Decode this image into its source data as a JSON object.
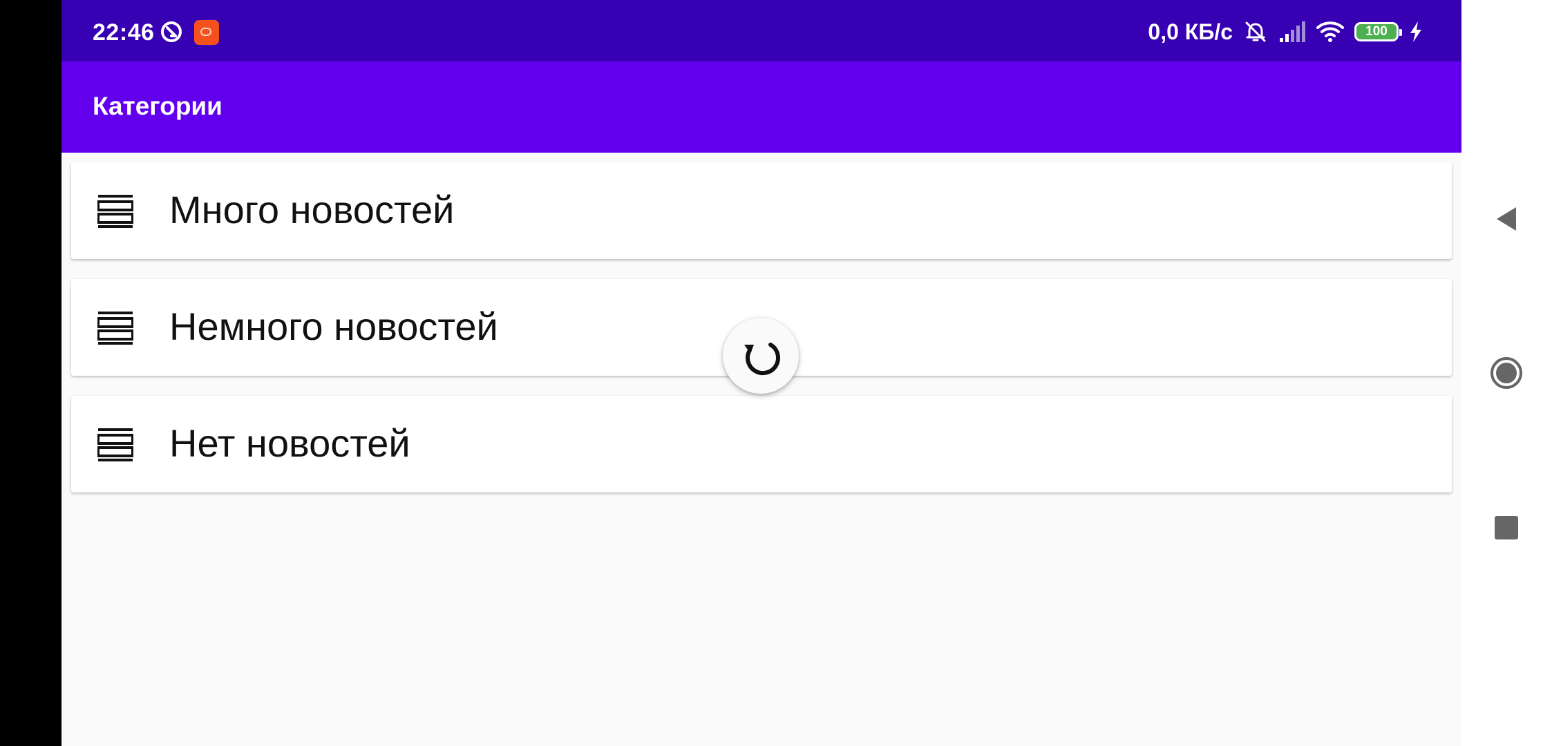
{
  "status_bar": {
    "time": "22:46",
    "net_speed": "0,0 КБ/с",
    "battery_level": "100",
    "icons": [
      "dnd-icon",
      "app-notification-icon",
      "muted-bell-icon",
      "signal-icon",
      "wifi-icon",
      "battery-icon",
      "charging-icon"
    ]
  },
  "app_bar": {
    "title": "Категории"
  },
  "categories": [
    {
      "label": "Много новостей",
      "icon": "list-icon"
    },
    {
      "label": "Немного новостей",
      "icon": "list-icon"
    },
    {
      "label": "Нет новостей",
      "icon": "list-icon"
    }
  ],
  "refresh": {
    "icon": "refresh-icon"
  },
  "nav_bar": {
    "buttons": [
      "back-icon",
      "home-icon",
      "recents-icon"
    ]
  },
  "colors": {
    "status_bar": "#3700b3",
    "app_bar": "#6200ee",
    "background": "#fafafa",
    "card": "#ffffff",
    "battery_fill": "#4caf50"
  }
}
